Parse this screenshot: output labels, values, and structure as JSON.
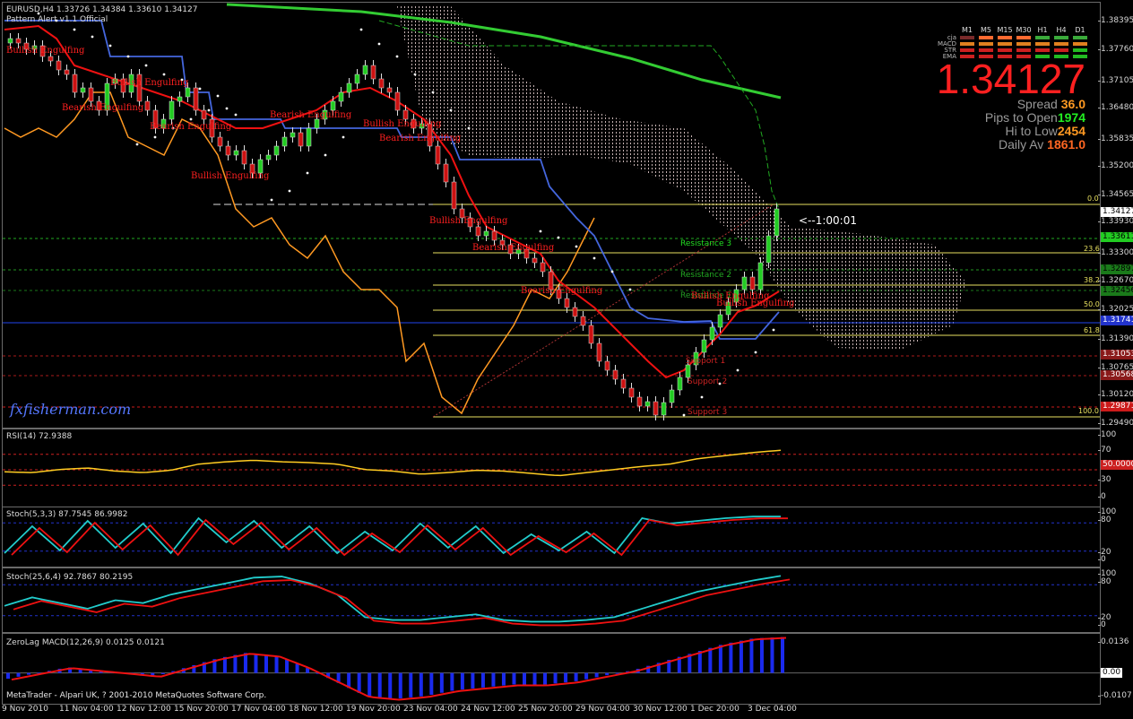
{
  "header": {
    "symbol_line": "EURUSD,H4  1.33726 1.34384 1.33610 1.34127",
    "indicator": "Pattern Alert v1.1 Official"
  },
  "watermark": "fxfisherman.com",
  "footer_text": "MetaTrader - Alpari UK, ? 2001-2010 MetaQuotes Software Corp.",
  "info_panel": {
    "grid_rows": [
      "cja",
      "MACD",
      "STR",
      "EMA"
    ],
    "grid_cols": [
      "M1",
      "M5",
      "M15",
      "M30",
      "H1",
      "H4",
      "D1"
    ],
    "grid_colors": [
      [
        "#7a2a2a",
        "#ff6a30",
        "#ff6a30",
        "#ff6a30",
        "#3aaa3a",
        "#3aaa3a",
        "#3aaa3a"
      ],
      [
        "#e08020",
        "#e08020",
        "#e08020",
        "#e08020",
        "#e08020",
        "#e08020",
        "#e08020"
      ],
      [
        "#cc2020",
        "#cc2020",
        "#cc2020",
        "#cc2020",
        "#cc2020",
        "#cc2020",
        "#22bb22"
      ],
      [
        "#cc2020",
        "#cc2020",
        "#cc2020",
        "#cc2020",
        "#22bb22",
        "#22bb22",
        "#22bb22"
      ]
    ],
    "price": "1.34127",
    "price_color": "#ff2020",
    "spread_label": "Spread",
    "spread_value": "36.0",
    "pips_label": "Pips to Open",
    "pips_value": "1974",
    "hilo_label": "Hi to Low",
    "hilo_value": "2454",
    "daily_label": "Daily Av",
    "daily_value": "1861.0"
  },
  "timer": "<--1:00:01",
  "price_axis": [
    "1.38395",
    "1.37760",
    "1.37105",
    "1.36480",
    "1.35835",
    "1.35200",
    "1.34565",
    "1.33930",
    "1.33300",
    "1.32670",
    "1.32025",
    "1.31390",
    "1.30765",
    "1.30120",
    "1.29490"
  ],
  "price_labels": [
    {
      "text": "1.34127",
      "bg": "#ffffff",
      "fg": "#000000"
    },
    {
      "text": "1.33611",
      "bg": "#22cc22",
      "fg": "#000000"
    },
    {
      "text": "1.32897",
      "bg": "#1a7a1a",
      "fg": "#000000"
    },
    {
      "text": "1.32456",
      "bg": "#1a7a1a",
      "fg": "#000000"
    },
    {
      "text": "1.31741",
      "bg": "#2233cc",
      "fg": "#ffffff"
    },
    {
      "text": "1.31053",
      "bg": "#8a1a1a",
      "fg": "#ffffff"
    },
    {
      "text": "1.30568",
      "bg": "#8a1a1a",
      "fg": "#ffffff"
    },
    {
      "text": "1.29871",
      "bg": "#cc1a1a",
      "fg": "#ffffff"
    }
  ],
  "fib_levels": [
    "0.0",
    "23.6",
    "38.2",
    "50.0",
    "61.8",
    "100.0"
  ],
  "sr_levels": [
    "Resistance 3",
    "Resistance 2",
    "Resistance 1",
    "Support 1",
    "Support 2",
    "Support 3"
  ],
  "patterns": [
    "Bullish Engulfing",
    "Bearish Engulfing",
    "Bullish Engulfing",
    "Bearish Engulfing",
    "Bullish Engulfing",
    "Bearish Engulfing",
    "Bullish Engulfing",
    "Bearish Engulfing",
    "Bullish Engulfing",
    "Bearish Engulfing",
    "Bearish Engulfing",
    "Bullish Engulfing",
    "Bullish Engulfing"
  ],
  "panes": {
    "rsi": {
      "title": "RSI(14) 72.9388",
      "scale": [
        "100",
        "70",
        "50.0000",
        "30",
        "0"
      ]
    },
    "stoch1": {
      "title": "Stoch(5,3,3) 87.7545 86.9982",
      "scale": [
        "100",
        "80",
        "20",
        "0"
      ]
    },
    "stoch2": {
      "title": "Stoch(25,6,4) 92.7867 80.2195",
      "scale": [
        "100",
        "80",
        "20",
        "0"
      ]
    },
    "macd": {
      "title": "ZeroLag MACD(12,26,9) 0.0125 0.0121",
      "scale": [
        "0.0136",
        "0.00",
        "-0.0107"
      ]
    }
  },
  "time_axis": [
    "9 Nov 2010",
    "11 Nov 04:00",
    "12 Nov 12:00",
    "15 Nov 20:00",
    "17 Nov 04:00",
    "18 Nov 12:00",
    "19 Nov 20:00",
    "23 Nov 04:00",
    "24 Nov 12:00",
    "25 Nov 20:00",
    "29 Nov 04:00",
    "30 Nov 12:00",
    "1 Dec 20:00",
    "3 Dec 04:00"
  ],
  "chart_data": {
    "type": "line",
    "title": "EURUSD,H4",
    "series": [
      {
        "name": "RSI(14)",
        "values": [
          45,
          44,
          48,
          50,
          46,
          44,
          47,
          55,
          58,
          60,
          58,
          57,
          55,
          48,
          46,
          42,
          44,
          47,
          46,
          43,
          40,
          44,
          48,
          52,
          55,
          62,
          66,
          70,
          73
        ]
      },
      {
        "name": "Stoch(5,3,3) %K",
        "values": [
          20,
          70,
          25,
          80,
          30,
          75,
          20,
          85,
          40,
          80,
          30,
          70,
          20,
          60,
          25,
          75,
          30,
          70,
          20,
          55,
          25,
          60,
          20,
          85,
          75,
          80,
          85,
          88,
          88
        ]
      },
      {
        "name": "Stoch(25,6,4) %K",
        "values": [
          40,
          55,
          45,
          35,
          50,
          45,
          60,
          70,
          80,
          90,
          92,
          80,
          60,
          20,
          15,
          15,
          20,
          25,
          15,
          12,
          12,
          15,
          20,
          35,
          50,
          65,
          75,
          85,
          93
        ]
      },
      {
        "name": "ZeroLag MACD",
        "values": [
          -0.002,
          0.0,
          0.002,
          0.001,
          0.0,
          -0.001,
          0.002,
          0.005,
          0.007,
          0.006,
          0.002,
          -0.003,
          -0.008,
          -0.009,
          -0.008,
          -0.006,
          -0.005,
          -0.004,
          -0.004,
          -0.003,
          -0.001,
          0.001,
          0.004,
          0.007,
          0.01,
          0.012,
          0.0125
        ]
      }
    ],
    "ylim_macd": [
      -0.0107,
      0.0136
    ]
  }
}
